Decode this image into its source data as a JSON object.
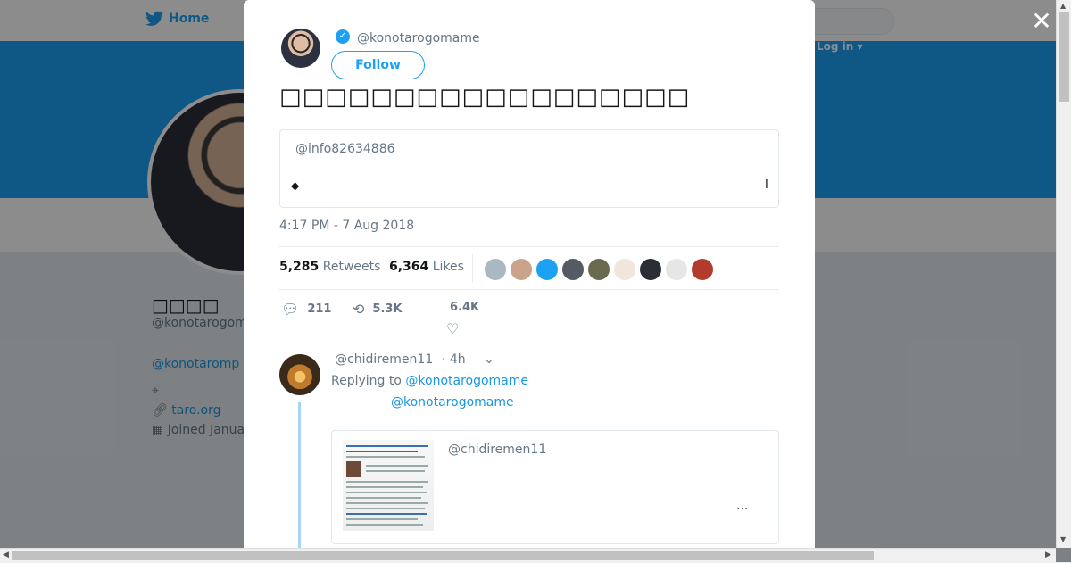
{
  "background": {
    "nav": {
      "home_label": "Home"
    },
    "login_label": "Log in ▾",
    "profile": {
      "name": "□□□□",
      "handle": "@konotarogom",
      "bio_link": "@konotaromp",
      "website": "taro.org",
      "joined": "Joined Janua"
    }
  },
  "modal": {
    "author": {
      "handle": "@konotarogomame",
      "verified": true
    },
    "follow_label": "Follow",
    "tweet_text": "□□□□□□□□□□□□□□□□□□",
    "quote": {
      "handle": "@info82634886",
      "text": "◆—",
      "right_mark": "I"
    },
    "timestamp": "4:17 PM - 7 Aug 2018",
    "stats": {
      "retweets_count": "5,285",
      "retweets_label": "Retweets",
      "likes_count": "6,364",
      "likes_label": "Likes"
    },
    "likers_colors": [
      "#aab8c2",
      "#c9a48a",
      "#1da1f2",
      "#555b63",
      "#6b6a4e",
      "#f0e6dc",
      "#2a2f36",
      "#e6e6e6",
      "#b23b2e"
    ],
    "actions": {
      "replies": "211",
      "retweets": "5.3K",
      "likes": "6.4K"
    },
    "reply": {
      "handle": "@chidiremen11",
      "time": "· 4h",
      "replying_prefix": "Replying to",
      "replying_to": "@konotarogomame",
      "mention": "@konotarogomame",
      "card": {
        "handle": "@chidiremen11",
        "more": "..."
      }
    }
  },
  "close_label": "✕",
  "colors": {
    "accent": "#1da1f2",
    "text": "#14171a",
    "muted": "#657786"
  }
}
